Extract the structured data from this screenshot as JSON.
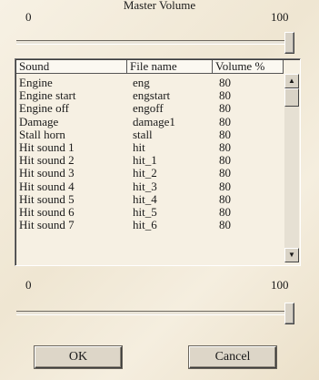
{
  "master_volume": {
    "title": "Master Volume",
    "min_label": "0",
    "max_label": "100",
    "value": 100
  },
  "table": {
    "headers": [
      "Sound",
      "File name",
      "Volume %"
    ],
    "rows": [
      [
        "Engine",
        "eng",
        "80"
      ],
      [
        "Engine start",
        "engstart",
        "80"
      ],
      [
        "Engine off",
        "engoff",
        "80"
      ],
      [
        "Damage",
        "damage1",
        "80"
      ],
      [
        "Stall horn",
        "stall",
        "80"
      ],
      [
        "Hit sound 1",
        "hit",
        "80"
      ],
      [
        "Hit sound 2",
        "hit_1",
        "80"
      ],
      [
        "Hit sound 3",
        "hit_2",
        "80"
      ],
      [
        "Hit sound 4",
        "hit_3",
        "80"
      ],
      [
        "Hit sound 5",
        "hit_4",
        "80"
      ],
      [
        "Hit sound 6",
        "hit_5",
        "80"
      ],
      [
        "Hit sound 7",
        "hit_6",
        "80"
      ]
    ]
  },
  "sound_volume": {
    "min_label": "0",
    "max_label": "100",
    "value": 100
  },
  "buttons": {
    "ok": "OK",
    "cancel": "Cancel"
  }
}
